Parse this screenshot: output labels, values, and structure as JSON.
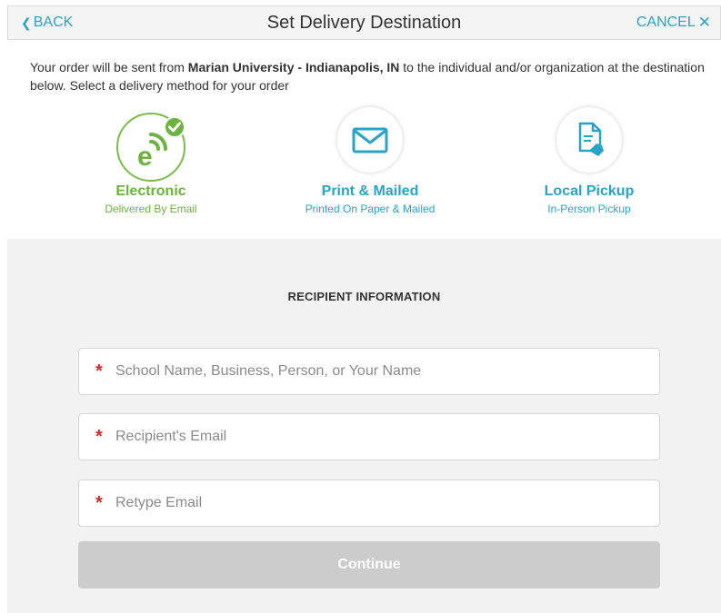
{
  "header": {
    "back_label": "BACK",
    "title": "Set Delivery Destination",
    "cancel_label": "CANCEL"
  },
  "intro": {
    "text_before": "Your order will be sent from ",
    "origin": "Marian University - Indianapolis, IN",
    "text_after": " to the individual and/or organization at the destination below. Select a delivery method for your order"
  },
  "delivery_methods": [
    {
      "label": "Electronic",
      "sub": "Delivered By Email",
      "icon": "electronic-icon",
      "selected": true,
      "color": "#6cb33f"
    },
    {
      "label": "Print & Mailed",
      "sub": "Printed On Paper & Mailed",
      "icon": "envelope-icon",
      "selected": false,
      "color": "#29a4c7"
    },
    {
      "label": "Local Pickup",
      "sub": "In-Person Pickup",
      "icon": "document-hand-icon",
      "selected": false,
      "color": "#29a4c7"
    }
  ],
  "form": {
    "heading": "RECIPIENT INFORMATION",
    "fields": [
      {
        "placeholder": "School Name, Business, Person, or Your Name",
        "value": "",
        "required": true
      },
      {
        "placeholder": "Recipient's Email",
        "value": "",
        "required": true
      },
      {
        "placeholder": "Retype Email",
        "value": "",
        "required": true
      }
    ],
    "continue_label": "Continue"
  },
  "colors": {
    "accent_blue": "#29a4c7",
    "accent_green": "#6cb33f",
    "required_red": "#c9302c",
    "disabled_button": "#cccccc"
  }
}
